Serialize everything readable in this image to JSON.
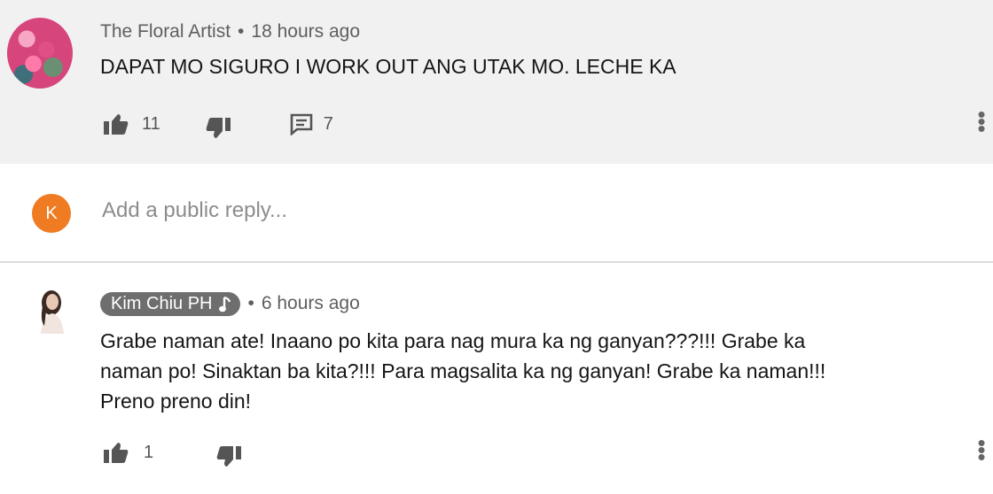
{
  "comment1": {
    "author": "The Floral Artist",
    "time": "18 hours ago",
    "text": "DAPAT MO SIGURO I WORK OUT ANG UTAK MO. LECHE KA",
    "likes": "11",
    "replies": "7"
  },
  "reply_box": {
    "avatar_letter": "K",
    "placeholder": "Add a public reply..."
  },
  "comment2": {
    "author": "Kim Chiu PH",
    "time": "6 hours ago",
    "text_lines": [
      "Grabe naman ate! Inaano po kita para nag mura ka ng ganyan???!!! Grabe ka",
      "naman po! Sinaktan ba kita?!!! Para magsalita ka ng ganyan! Grabe ka naman!!!",
      "Preno preno din!"
    ],
    "likes": "1"
  },
  "icons": {
    "like": "thumbs-up-icon",
    "dislike": "thumbs-down-icon",
    "reply": "comment-icon",
    "music": "music-note-icon",
    "menu": "more-vert-icon"
  },
  "colors": {
    "top_bg": "#f1f1f1",
    "reply_avatar": "#ef7c22",
    "badge_bg": "#6e6e6e"
  }
}
